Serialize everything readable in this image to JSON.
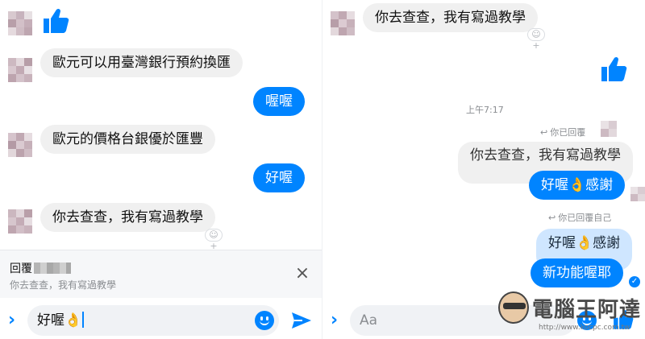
{
  "colors": {
    "accent": "#0084ff",
    "incoming": "#f0f0f0",
    "quote_light": "#cfe6ff"
  },
  "left": {
    "messages": [
      {
        "id": "m1",
        "text": "歐元可以用臺灣銀行預約換匯",
        "dir": "in"
      },
      {
        "id": "m2",
        "text": "喔喔",
        "dir": "out"
      },
      {
        "id": "m3",
        "text": "歐元的價格台銀優於匯豐",
        "dir": "in"
      },
      {
        "id": "m4",
        "text": "好喔",
        "dir": "out"
      },
      {
        "id": "m5",
        "text": "你去查查，我有寫過教學",
        "dir": "in"
      }
    ],
    "react_add_label": "☺+",
    "reply": {
      "title": "回覆",
      "snippet": "你去查查，我有寫過教學",
      "close_icon": "×"
    },
    "composer": {
      "value": "好喔👌"
    }
  },
  "right": {
    "messages": [
      {
        "id": "r1",
        "text": "你去查查，我有寫過教學",
        "dir": "in"
      }
    ],
    "timestamp": "上午7:17",
    "reply1": {
      "label": "你已回覆",
      "quoted": "你去查查，我有寫過教學",
      "text": "好喔👌感謝"
    },
    "reply2": {
      "label": "你已回覆自己",
      "quoted": "好喔👌感謝",
      "text": "新功能喔耶"
    },
    "composer": {
      "placeholder": "Aa"
    }
  },
  "watermark": {
    "text": "電腦王阿達",
    "url": "http://www.kocpc.com.tw"
  }
}
